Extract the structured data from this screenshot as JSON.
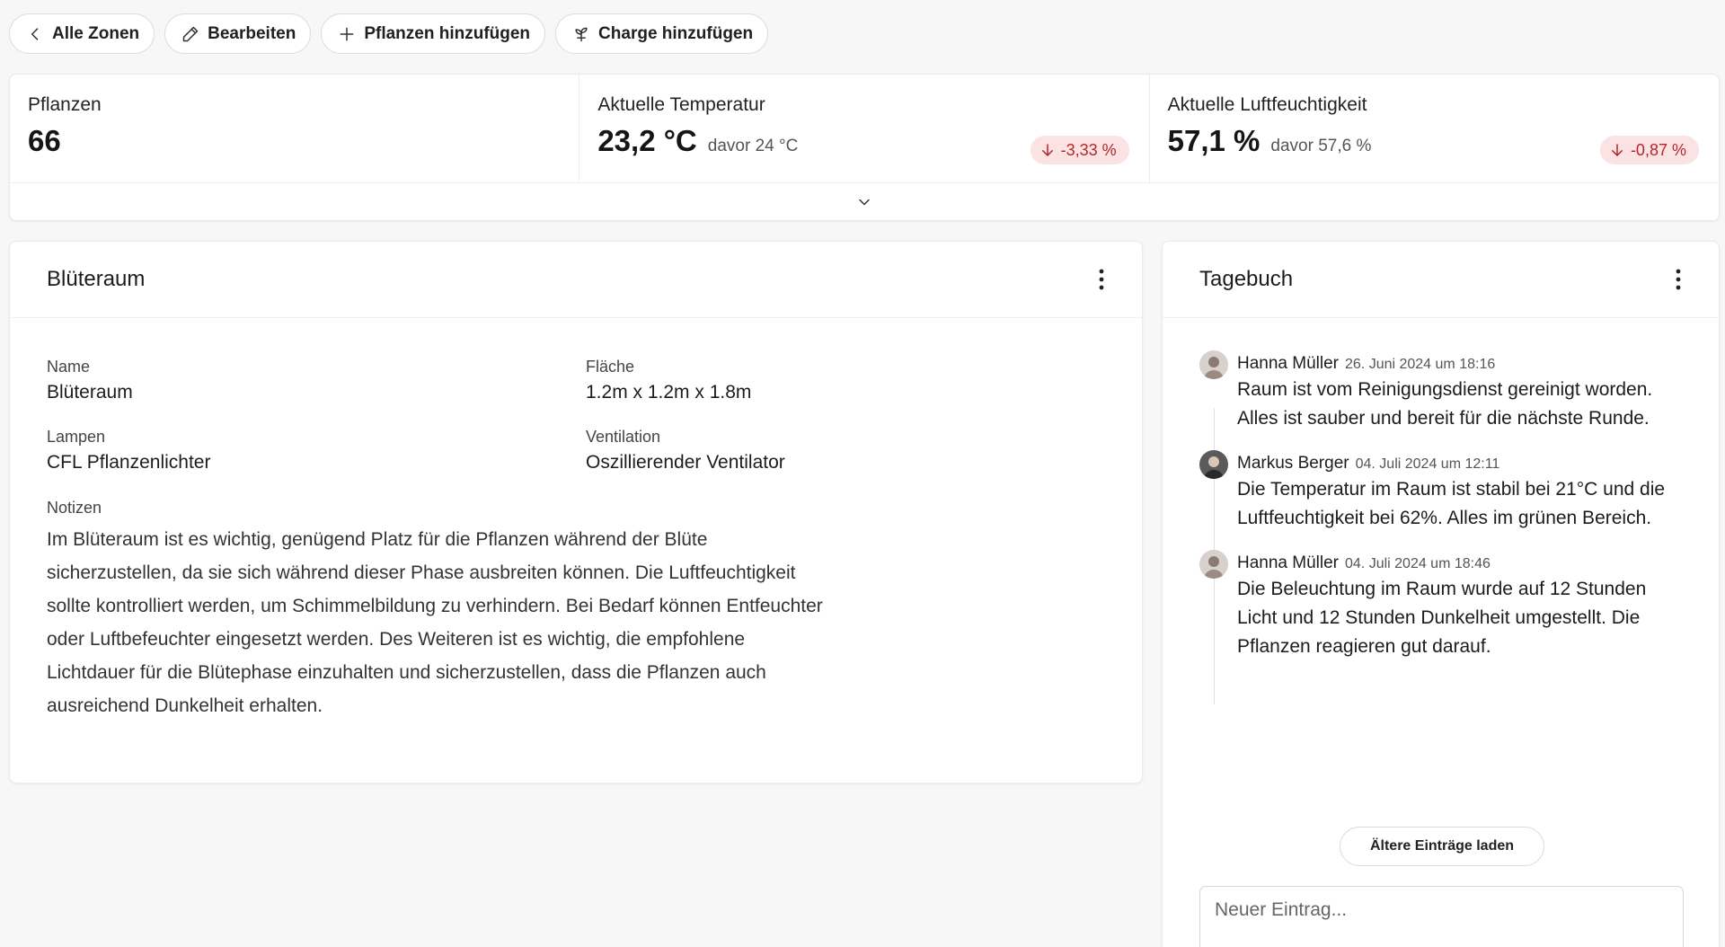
{
  "toolbar": {
    "back_label": "Alle Zonen",
    "edit_label": "Bearbeiten",
    "add_plants_label": "Pflanzen hinzufügen",
    "add_batch_label": "Charge hinzufügen"
  },
  "stats": {
    "plants": {
      "label": "Pflanzen",
      "value": "66"
    },
    "temperature": {
      "label": "Aktuelle Temperatur",
      "value": "23,2 °C",
      "previous": "davor 24 °C",
      "change": "-3,33 %"
    },
    "humidity": {
      "label": "Aktuelle Luftfeuchtigkeit",
      "value": "57,1 %",
      "previous": "davor 57,6 %",
      "change": "-0,87 %"
    }
  },
  "zone": {
    "title": "Blüteraum",
    "fields": {
      "name_label": "Name",
      "name_value": "Blüteraum",
      "area_label": "Fläche",
      "area_value": "1.2m x 1.2m x 1.8m",
      "lamps_label": "Lampen",
      "lamps_value": "CFL Pflanzenlichter",
      "ventilation_label": "Ventilation",
      "ventilation_value": "Oszillierender Ventilator"
    },
    "notes_label": "Notizen",
    "notes_text": "Im Blüteraum ist es wichtig, genügend Platz für die Pflanzen während der Blüte sicherzustellen, da sie sich während dieser Phase ausbreiten können. Die Luftfeuchtigkeit sollte kontrolliert werden, um Schimmelbildung zu verhindern. Bei Bedarf können Entfeuchter oder Luftbefeuchter eingesetzt werden. Des Weiteren ist es wichtig, die empfohlene Lichtdauer für die Blütephase einzuhalten und sicherzustellen, dass die Pflanzen auch ausreichend Dunkelheit erhalten."
  },
  "diary": {
    "title": "Tagebuch",
    "entries": [
      {
        "author": "Hanna Müller",
        "date": "26. Juni 2024 um 18:16",
        "text": "Raum ist vom Reinigungsdienst gereinigt worden. Alles ist sauber und bereit für die nächste Runde."
      },
      {
        "author": "Markus Berger",
        "date": "04. Juli 2024 um 12:11",
        "text": "Die Temperatur im Raum ist stabil bei 21°C und die Luftfeuchtigkeit bei 62%. Alles im grünen Bereich."
      },
      {
        "author": "Hanna Müller",
        "date": "04. Juli 2024 um 18:46",
        "text": "Die Beleuchtung im Raum wurde auf 12 Stunden Licht und 12 Stunden Dunkelheit umgestellt. Die Pflanzen reagieren gut darauf."
      }
    ],
    "load_more_label": "Ältere Einträge laden",
    "new_entry_placeholder": "Neuer Eintrag..."
  },
  "colors": {
    "background": "#f8f7f7",
    "negative_badge_bg": "#fbe3e3",
    "negative_badge_text": "#b3262b"
  },
  "icons": {
    "back": "chevron-left-icon",
    "edit": "pencil-icon",
    "add": "plus-icon",
    "batch": "plant-icon",
    "trend_down": "arrow-down-icon",
    "expand": "chevron-down-icon",
    "menu": "kebab-icon"
  }
}
